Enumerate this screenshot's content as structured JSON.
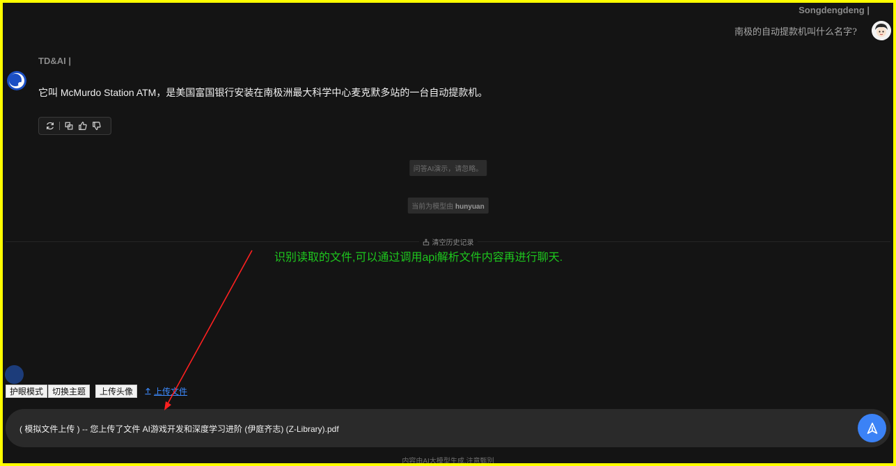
{
  "user": {
    "name": "Songdengdeng |",
    "message": "南极的自动提款机叫什么名字?"
  },
  "ai": {
    "name": "TD&AI |",
    "message": "它叫 McMurdo Station ATM，是美国富国银行安装在南极洲最大科学中心麦克默多站的一台自动提款机。"
  },
  "notices": {
    "disclaimer": "问答AI演示，请忽略。",
    "model_prefix": "当前为模型由",
    "model_name": "hunyuan"
  },
  "clear_history": "清空历史记录",
  "annotation": "识别读取的文件,可以通过调用api解析文件内容再进行聊天.",
  "toolbar": {
    "eye_mode": "护眼模式",
    "switch_theme": "切换主题",
    "upload_avatar": "上传头像",
    "upload_file": "上传文件"
  },
  "input": {
    "value": "( 模拟文件上传 ) -- 您上传了文件 AI游戏开发和深度学习进阶 (伊庭齐志) (Z-Library).pdf"
  },
  "footer": "内容由AI大模型生成,注意甄别",
  "colors": {
    "background": "#141414",
    "accent": "#3b82f6",
    "annotation": "#1ec81e",
    "arrow": "#ff2020",
    "frame": "#ffff00"
  },
  "icons": [
    "refresh-icon",
    "copy-icon",
    "thumbs-up-icon",
    "thumbs-down-icon",
    "clear-icon",
    "upload-icon",
    "send-icon"
  ]
}
